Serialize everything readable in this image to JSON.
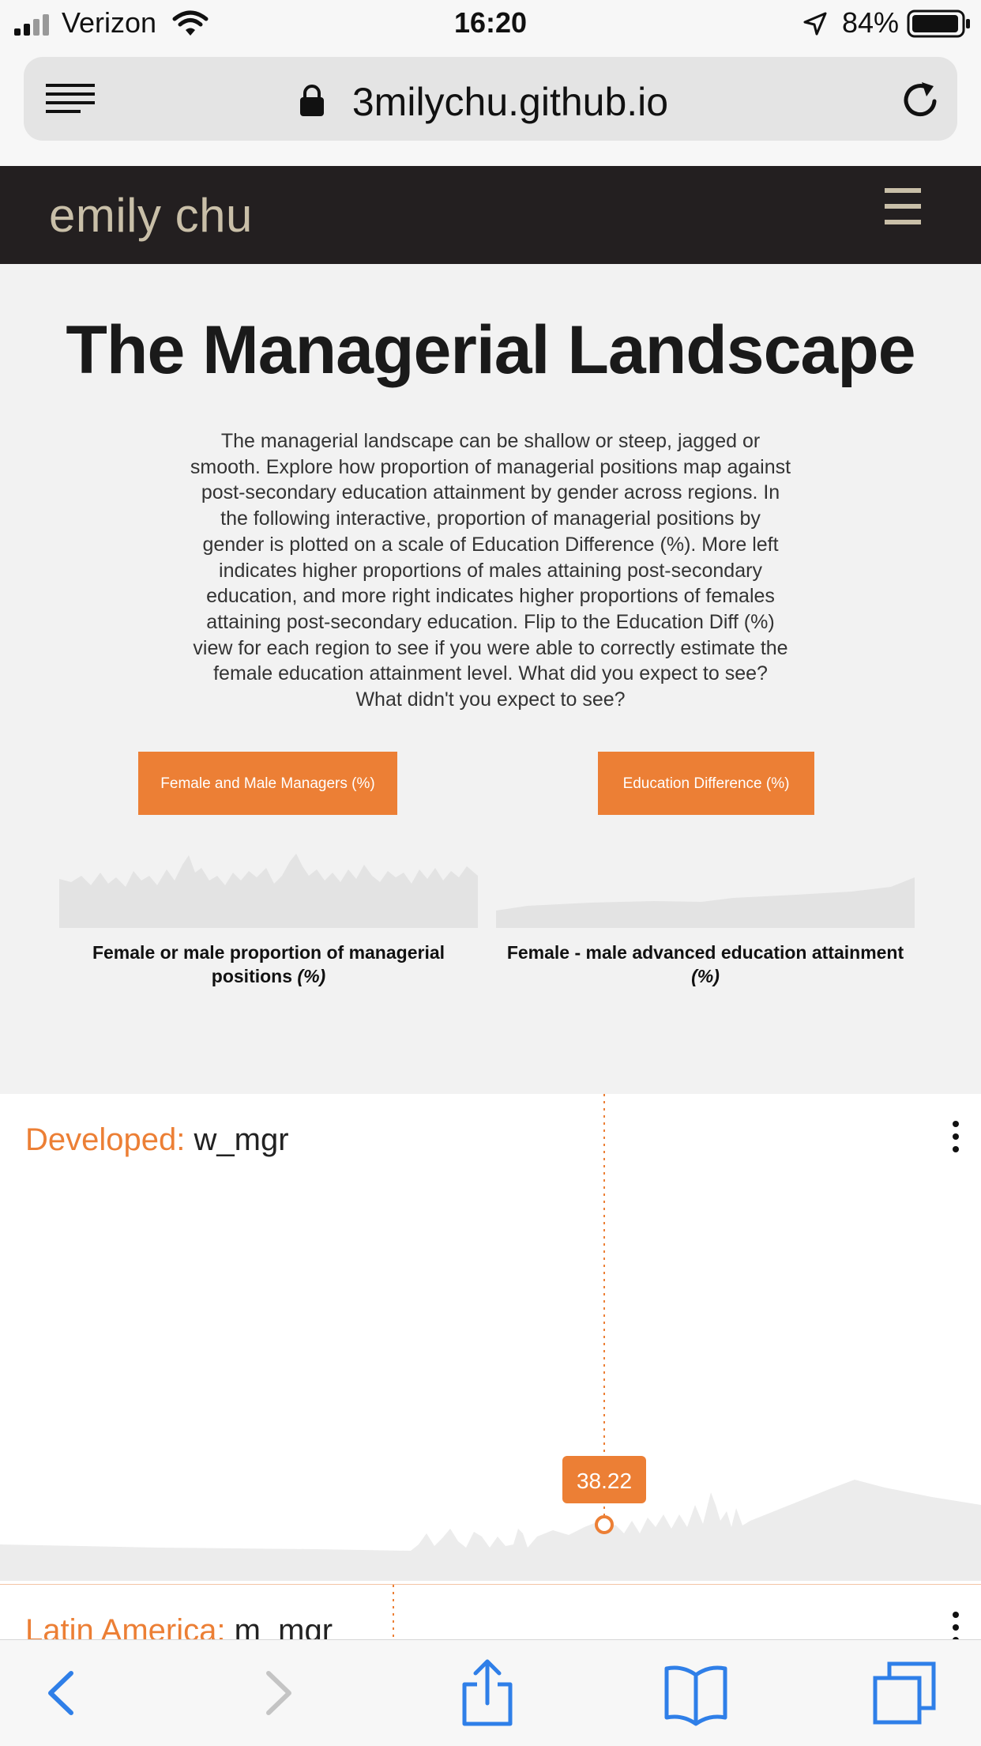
{
  "status_bar": {
    "carrier": "Verizon",
    "time": "16:20",
    "battery": "84%"
  },
  "browser": {
    "url": "3milychu.github.io"
  },
  "site": {
    "brand": "emily chu"
  },
  "intro": {
    "title": "The Managerial Landscape",
    "description": "The managerial landscape can be shallow or steep, jagged or smooth. Explore how proportion of managerial positions map against post-secondary education attainment by gender across regions. In the following interactive, proportion of managerial positions by gender is plotted on a scale of Education Difference (%). More left indicates higher proportions of males attaining post-secondary education, and more right indicates higher proportions of females attaining post-secondary education. Flip to the Education Diff (%) view for each region to see if you were able to correctly estimate the female education attainment level. What did you expect to see? What didn't you expect to see?",
    "buttons": {
      "managers": "Female and Male Managers (%)",
      "education": "Education Difference (%)"
    },
    "captions": {
      "left_main": "Female or male proportion of managerial positions",
      "left_unit": "(%)",
      "right_main": "Female - male advanced education attainment",
      "right_unit": "(%)"
    }
  },
  "charts": {
    "developed": {
      "region": "Developed:",
      "metric": "w_mgr",
      "value_label": "38.22"
    },
    "latin_america": {
      "region": "Latin America:",
      "metric": "m_mgr"
    }
  },
  "colors": {
    "accent": "#ec7f35",
    "nav_bg": "#231f20",
    "brand": "#c9bfa8",
    "ios_blue": "#2f7fe8"
  },
  "icons": {
    "status": [
      "signal-icon",
      "wifi-icon",
      "location-icon",
      "battery-icon"
    ],
    "browser": [
      "reader-menu-icon",
      "lock-icon",
      "reload-icon"
    ],
    "toolbar": [
      "back-icon",
      "forward-icon",
      "share-icon",
      "bookmarks-icon",
      "tabs-icon"
    ]
  }
}
